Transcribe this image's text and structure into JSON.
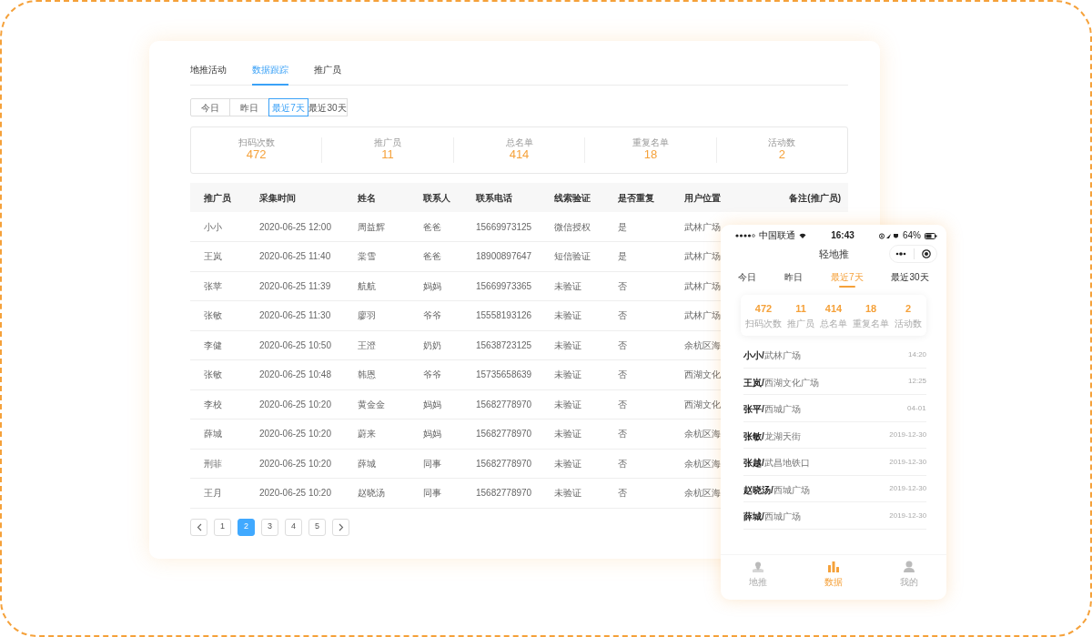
{
  "dashboard": {
    "tabs": [
      {
        "label": "地推活动",
        "selected": false
      },
      {
        "label": "数据跟踪",
        "selected": true
      },
      {
        "label": "推广员",
        "selected": false
      }
    ],
    "ranges": [
      {
        "label": "今日",
        "selected": false
      },
      {
        "label": "昨日",
        "selected": false
      },
      {
        "label": "最近7天",
        "selected": true
      },
      {
        "label": "最近30天",
        "selected": false
      }
    ],
    "stats": [
      {
        "label": "扫码次数",
        "value": "472"
      },
      {
        "label": "推广员",
        "value": "11"
      },
      {
        "label": "总名单",
        "value": "414"
      },
      {
        "label": "重复名单",
        "value": "18"
      },
      {
        "label": "活动数",
        "value": "2"
      }
    ],
    "table": {
      "columns": [
        "推广员",
        "采集时间",
        "姓名",
        "联系人",
        "联系电话",
        "线索验证",
        "是否重复",
        "用户位置",
        "备注(推广员)"
      ],
      "rows": [
        [
          "小小",
          "2020-06-25 12:00",
          "周益辉",
          "爸爸",
          "15669973125",
          "微信授权",
          "是",
          "武林广场"
        ],
        [
          "王岚",
          "2020-06-25 11:40",
          "棠雪",
          "爸爸",
          "18900897647",
          "短信验证",
          "是",
          "武林广场"
        ],
        [
          "张苹",
          "2020-06-25 11:39",
          "航航",
          "妈妈",
          "15669973365",
          "未验证",
          "否",
          "武林广场"
        ],
        [
          "张敏",
          "2020-06-25 11:30",
          "廖羽",
          "爷爷",
          "15558193126",
          "未验证",
          "否",
          "武林广场"
        ],
        [
          "李健",
          "2020-06-25 10:50",
          "王澄",
          "奶奶",
          "15638723125",
          "未验证",
          "否",
          "余杭区海"
        ],
        [
          "张敏",
          "2020-06-25 10:48",
          "韩恩",
          "爷爷",
          "15735658639",
          "未验证",
          "否",
          "西湖文化"
        ],
        [
          "李校",
          "2020-06-25 10:20",
          "黄金金",
          "妈妈",
          "15682778970",
          "未验证",
          "否",
          "西湖文化"
        ],
        [
          "薛城",
          "2020-06-25 10:20",
          "蔚来",
          "妈妈",
          "15682778970",
          "未验证",
          "否",
          "余杭区海"
        ],
        [
          "刑菲",
          "2020-06-25 10:20",
          "薛城",
          "同事",
          "15682778970",
          "未验证",
          "否",
          "余杭区海"
        ],
        [
          "王月",
          "2020-06-25 10:20",
          "赵晓汤",
          "同事",
          "15682778970",
          "未验证",
          "否",
          "余杭区海"
        ]
      ]
    },
    "pagination": [
      {
        "label": "1",
        "selected": false
      },
      {
        "label": "2",
        "selected": true
      },
      {
        "label": "3",
        "selected": false
      },
      {
        "label": "4",
        "selected": false
      },
      {
        "label": "5",
        "selected": false
      }
    ]
  },
  "phone": {
    "status_bar": {
      "carrier": "中国联通",
      "time": "16:43",
      "battery": "64%"
    },
    "title": "轻地推",
    "tabs": [
      {
        "label": "今日",
        "selected": false
      },
      {
        "label": "昨日",
        "selected": false
      },
      {
        "label": "最近7天",
        "selected": true
      },
      {
        "label": "最近30天",
        "selected": false
      }
    ],
    "stats": [
      {
        "label": "扫码次数",
        "value": "472"
      },
      {
        "label": "推广员",
        "value": "11"
      },
      {
        "label": "总名单",
        "value": "414"
      },
      {
        "label": "重复名单",
        "value": "18"
      },
      {
        "label": "活动数",
        "value": "2"
      }
    ],
    "records": [
      {
        "name": "小小/",
        "place": "武林广场",
        "time": "14:20"
      },
      {
        "name": "王岚/",
        "place": "西湖文化广场",
        "time": "12:25"
      },
      {
        "name": "张平/",
        "place": "西城广场",
        "time": "04-01"
      },
      {
        "name": "张敏/",
        "place": "龙湖天街",
        "time": "2019-12-30"
      },
      {
        "name": "张越/",
        "place": "武昌地铁口",
        "time": "2019-12-30"
      },
      {
        "name": "赵晓汤/",
        "place": "西城广场",
        "time": "2019-12-30"
      },
      {
        "name": "薛城/",
        "place": "西城广场",
        "time": "2019-12-30"
      }
    ],
    "nav": [
      {
        "label": "地推",
        "selected": false
      },
      {
        "label": "数据",
        "selected": true
      },
      {
        "label": "我的",
        "selected": false
      }
    ]
  }
}
